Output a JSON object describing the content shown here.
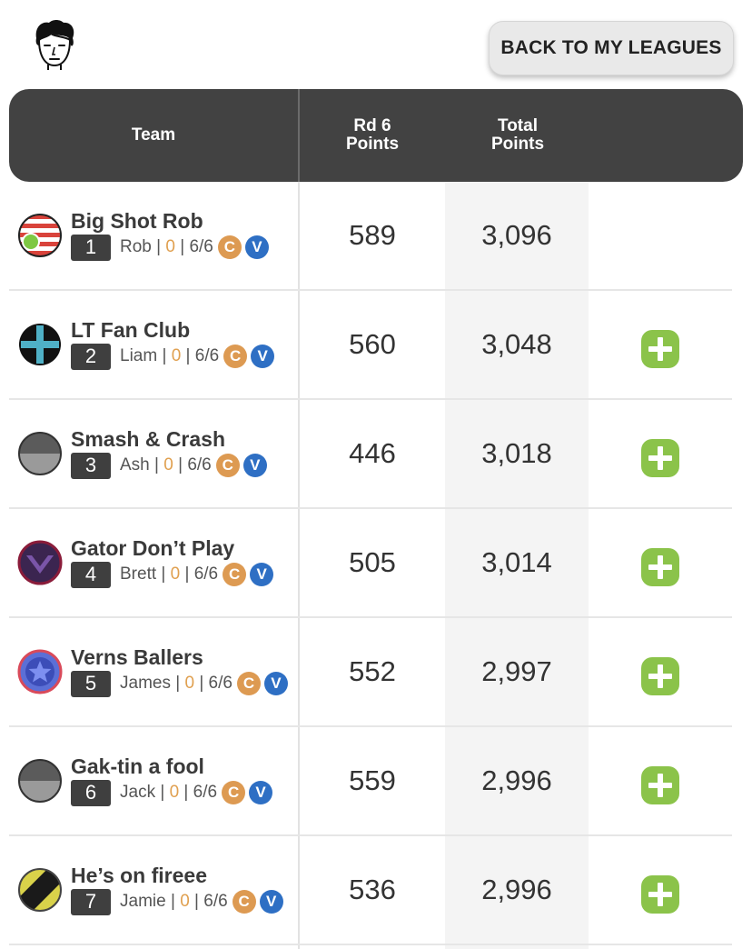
{
  "header": {
    "back_label": "BACK TO MY LEAGUES"
  },
  "table": {
    "col_team": "Team",
    "col_round_line1": "Rd 6",
    "col_round_line2": "Points",
    "col_total_line1": "Total",
    "col_total_line2": "Points"
  },
  "colors": {
    "header_bg": "#424242",
    "add_green": "#8bc34a",
    "captain": "#dd9a52",
    "vice": "#2e6fc4"
  },
  "rows": [
    {
      "name": "Big Shot Rob",
      "rank": "1",
      "manager": "Rob",
      "zero": "0",
      "picks": "6/6",
      "c": "C",
      "v": "V",
      "round": "589",
      "total": "3,096",
      "logo": "striped-flag-logo",
      "show_add": false
    },
    {
      "name": "LT Fan Club",
      "rank": "2",
      "manager": "Liam",
      "zero": "0",
      "picks": "6/6",
      "c": "C",
      "v": "V",
      "round": "560",
      "total": "3,048",
      "logo": "cross-logo",
      "show_add": true
    },
    {
      "name": "Smash & Crash",
      "rank": "3",
      "manager": "Ash",
      "zero": "0",
      "picks": "6/6",
      "c": "C",
      "v": "V",
      "round": "446",
      "total": "3,018",
      "logo": "grey-split-logo",
      "show_add": true
    },
    {
      "name": "Gator Don’t Play",
      "rank": "4",
      "manager": "Brett",
      "zero": "0",
      "picks": "6/6",
      "c": "C",
      "v": "V",
      "round": "505",
      "total": "3,014",
      "logo": "chevron-logo",
      "show_add": true
    },
    {
      "name": "Verns Ballers",
      "rank": "5",
      "manager": "James",
      "zero": "0",
      "picks": "6/6",
      "c": "C",
      "v": "V",
      "round": "552",
      "total": "2,997",
      "logo": "star-logo",
      "show_add": true
    },
    {
      "name": "Gak-tin a fool",
      "rank": "6",
      "manager": "Jack",
      "zero": "0",
      "picks": "6/6",
      "c": "C",
      "v": "V",
      "round": "559",
      "total": "2,996",
      "logo": "grey-split-logo",
      "show_add": true
    },
    {
      "name": "He’s on fireee",
      "rank": "7",
      "manager": "Jamie",
      "zero": "0",
      "picks": "6/6",
      "c": "C",
      "v": "V",
      "round": "536",
      "total": "2,996",
      "logo": "diagonal-stripe-logo",
      "show_add": true
    }
  ]
}
